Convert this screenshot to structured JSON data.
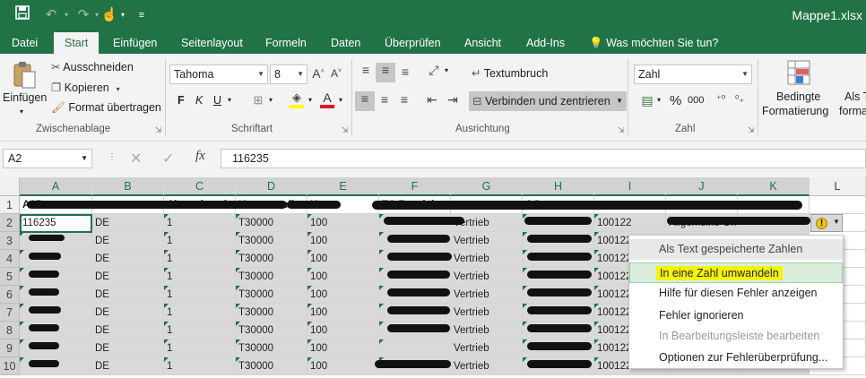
{
  "app": {
    "title": "Mappe1.xlsx"
  },
  "tabs": [
    "Datei",
    "Start",
    "Einfügen",
    "Seitenlayout",
    "Formeln",
    "Daten",
    "Überprüfen",
    "Ansicht",
    "Add-Ins"
  ],
  "tell_me": "Was möchten Sie tun?",
  "clipboard": {
    "paste": "Einfügen",
    "cut": "Ausschneiden",
    "copy": "Kopieren",
    "format_painter": "Format übertragen",
    "label": "Zwischenablage"
  },
  "font": {
    "name": "Tahoma",
    "size": "8",
    "bold": "F",
    "italic": "K",
    "underline": "U",
    "label": "Schriftart"
  },
  "alignment": {
    "wrap": "Textumbruch",
    "merge": "Verbinden und zentrieren",
    "label": "Ausrichtung"
  },
  "number": {
    "format": "Zahl",
    "label": "Zahl",
    "percent": "%",
    "comma": "000"
  },
  "styles": {
    "conditional_line1": "Bedingte",
    "conditional_line2": "Formatierung",
    "table_line1": "Als T",
    "table_line2": "forma"
  },
  "formula_bar": {
    "name_box": "A2",
    "value": "116235",
    "fx": "fx"
  },
  "columns": [
    "A",
    "B",
    "C",
    "D",
    "E",
    "F",
    "G",
    "H",
    "I",
    "J",
    "K",
    "L"
  ],
  "rows": [
    "1",
    "2",
    "3",
    "4",
    "5",
    "6",
    "7",
    "8",
    "9",
    "10"
  ],
  "header_row": [
    "A05",
    "",
    "Absatzkanal",
    "Kostenstelle",
    "Kz",
    "TC Bezeichnung",
    "",
    "AG",
    "",
    "",
    "",
    ""
  ],
  "data": {
    "col_b": "DE",
    "col_c": "1",
    "col_d": "T30000",
    "col_e": "100",
    "col_g": "Vertrieb",
    "col_i": "100122",
    "row2_a": "116235",
    "row2_j": "Allgemeine Original Sch"
  },
  "context_menu": {
    "header": "Als Text gespeicherte Zahlen",
    "items": [
      "In eine Zahl umwandeln",
      "Hilfe für diesen Fehler anzeigen",
      "Fehler ignorieren",
      "In Bearbeitungsleiste bearbeiten",
      "Optionen zur Fehlerüberprüfung..."
    ]
  },
  "colors": {
    "accent": "#217346",
    "highlight": "#f5f500",
    "selection": "#d9d9d9"
  }
}
